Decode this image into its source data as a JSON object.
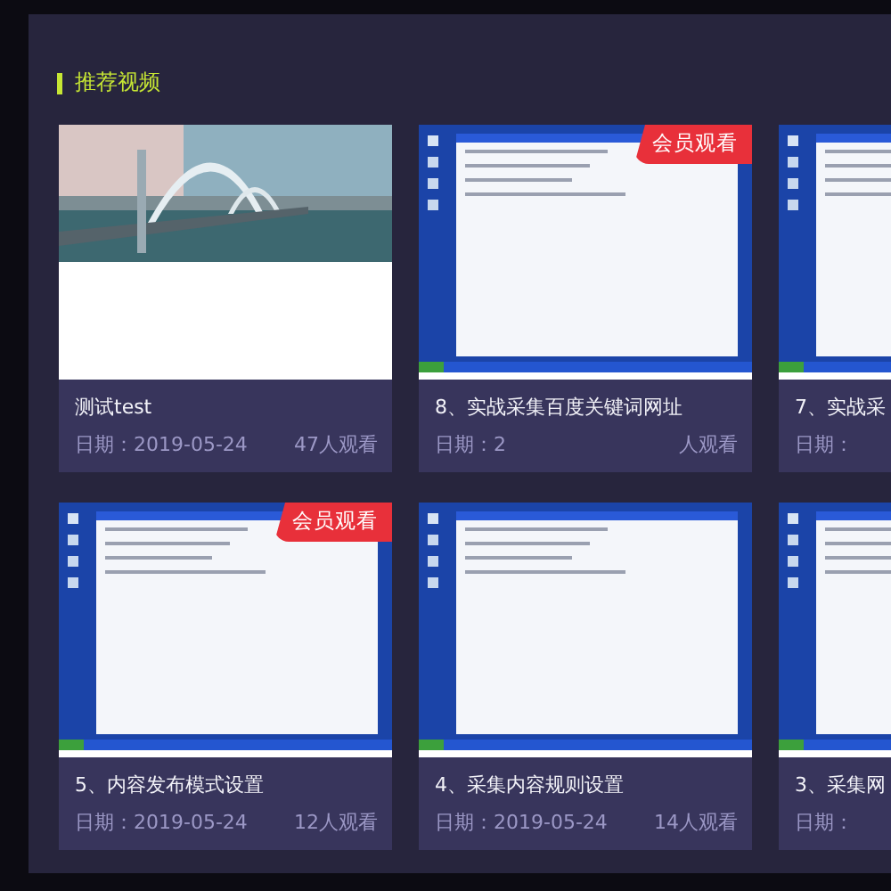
{
  "section": {
    "title": "推荐视频"
  },
  "cards": [
    {
      "title": "测试test",
      "date": "日期：2019-05-24",
      "views": "47人观看"
    },
    {
      "kind": "screen",
      "badge": "会员观看",
      "title": "8、实战采集百度关键词网址",
      "date": "日期：2",
      "views": "人观看"
    },
    {
      "kind": "screen",
      "title": "7、实战采",
      "date": "日期："
    },
    {
      "kind": "screen",
      "badge": "会员观看",
      "title": "5、内容发布模式设置",
      "date": "日期：2019-05-24",
      "views": "12人观看"
    },
    {
      "kind": "screen",
      "title": "4、采集内容规则设置",
      "date": "日期：2019-05-24",
      "views": "14人观看"
    },
    {
      "kind": "screen",
      "title": "3、采集网",
      "date": "日期："
    }
  ]
}
